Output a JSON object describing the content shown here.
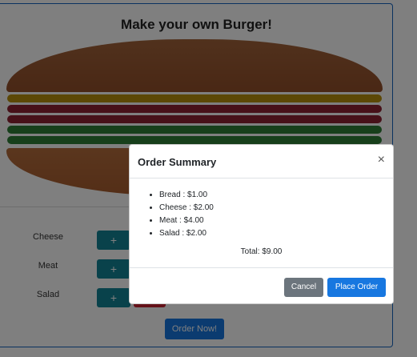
{
  "app": {
    "title": "Make your own Burger!",
    "order_button": "Order Now!"
  },
  "burger": {
    "colors": {
      "bread": "#9c5a32",
      "cheese": "#b8900c",
      "meat": "#8e2333",
      "salad": "#2f7f37"
    },
    "layers": [
      "cheese",
      "meat",
      "meat",
      "salad",
      "salad"
    ]
  },
  "controls": [
    {
      "label": "Cheese",
      "add_icon": "plus-icon"
    },
    {
      "label": "Meat",
      "add_icon": "plus-icon"
    },
    {
      "label": "Salad",
      "add_icon": "plus-icon"
    }
  ],
  "modal": {
    "title": "Order Summary",
    "close": "×",
    "items": [
      "Bread : $1.00",
      "Cheese : $2.00",
      "Meat : $4.00",
      "Salad : $2.00"
    ],
    "total": "Total: $9.00",
    "cancel_label": "Cancel",
    "place_label": "Place Order"
  }
}
